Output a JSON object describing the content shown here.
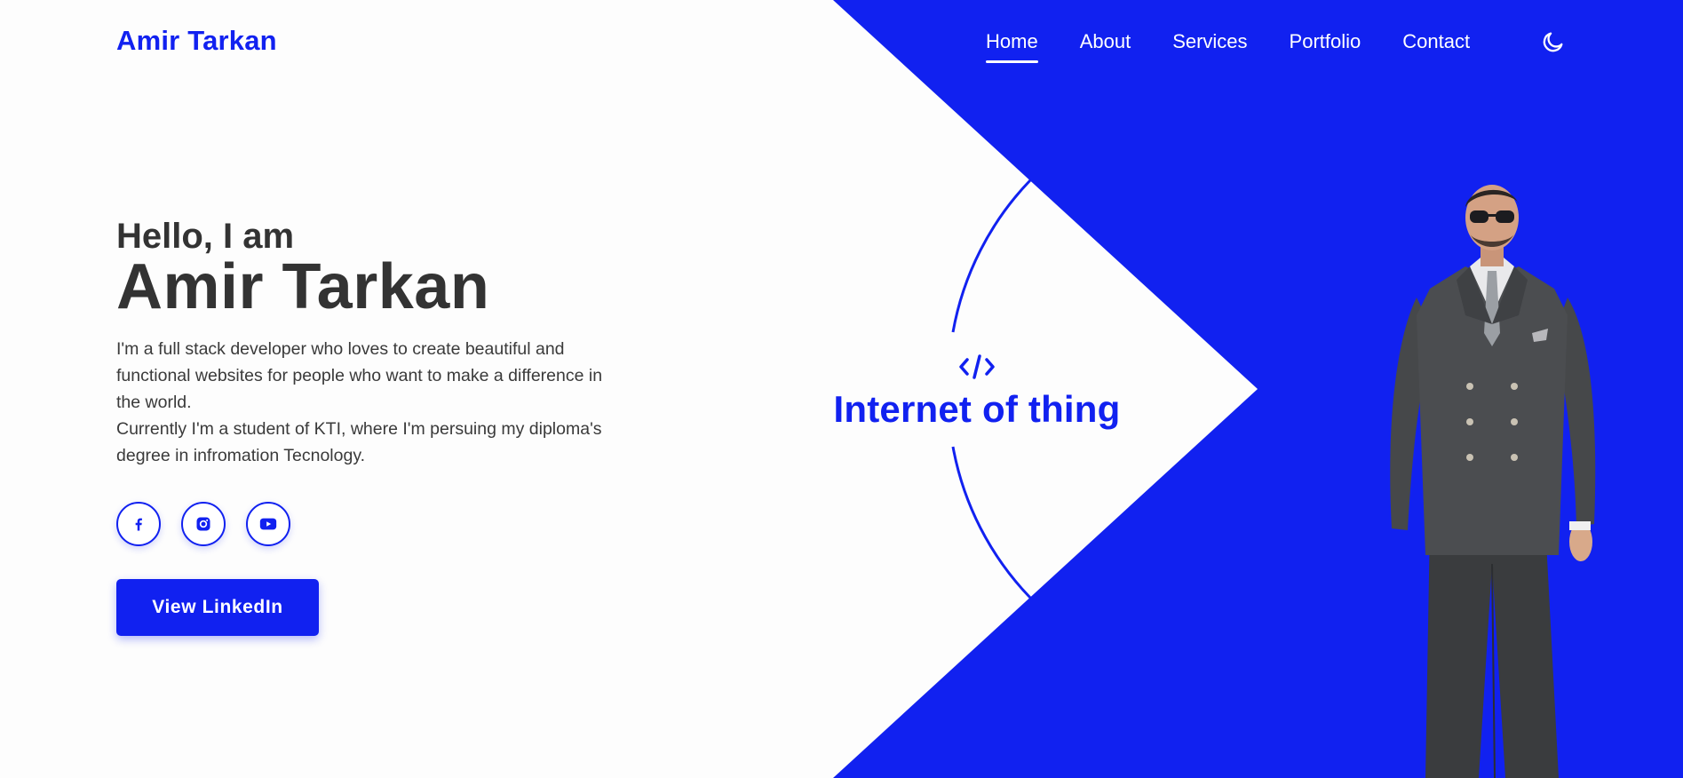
{
  "brand": {
    "name": "Amir Tarkan"
  },
  "nav": {
    "items": [
      {
        "label": "Home",
        "active": true
      },
      {
        "label": "About",
        "active": false
      },
      {
        "label": "Services",
        "active": false
      },
      {
        "label": "Portfolio",
        "active": false
      },
      {
        "label": "Contact",
        "active": false
      }
    ],
    "theme_icon": "moon-icon"
  },
  "hero": {
    "greeting": "Hello, I am",
    "name": "Amir Tarkan",
    "bio": [
      "I'm a full stack developer who loves to create beautiful and functional websites for people who want to make a difference in the world.",
      "Currently I'm a student of KTI, where I'm persuing my diploma's degree in infromation Tecnology."
    ],
    "socials": [
      {
        "icon": "facebook-icon"
      },
      {
        "icon": "instagram-icon"
      },
      {
        "icon": "youtube-icon"
      }
    ],
    "cta_label": "View LinkedIn"
  },
  "feature": {
    "icon": "code-icon",
    "title": "Internet of thing"
  },
  "colors": {
    "accent": "#1121f0",
    "background": "#fdfdfd",
    "text": "#333333",
    "nav_text": "#ffffff"
  }
}
